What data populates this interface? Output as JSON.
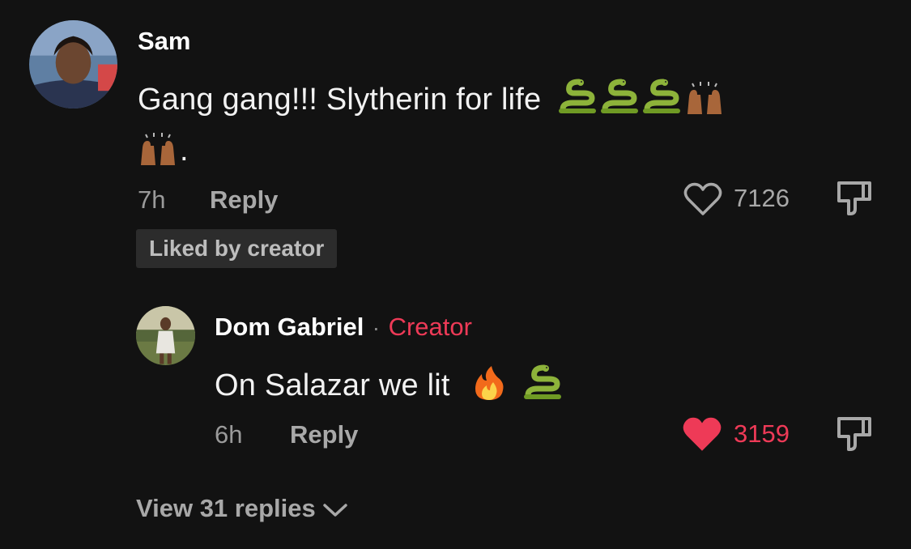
{
  "comment": {
    "author": "Sam",
    "text_line1": "Gang gang!!! Slytherin for life",
    "text_line2_suffix": ".",
    "emojis_line1": [
      "snake-emoji",
      "snake-emoji",
      "snake-emoji",
      "raising-hands-emoji"
    ],
    "emojis_line2": [
      "raising-hands-emoji"
    ],
    "time": "7h",
    "reply_label": "Reply",
    "like_count": "7126",
    "liked": false,
    "liked_by_creator_label": "Liked by creator"
  },
  "reply": {
    "author": "Dom Gabriel",
    "separator": "·",
    "creator_tag": "Creator",
    "text": "On Salazar we lit",
    "emojis": [
      "fire-emoji",
      "snake-emoji"
    ],
    "time": "6h",
    "reply_label": "Reply",
    "like_count": "3159",
    "liked": true
  },
  "view_replies_label": "View 31 replies",
  "colors": {
    "background": "#121212",
    "accent_red": "#ee3a57",
    "muted_text": "#a8a8a8",
    "badge_bg": "#2c2c2c"
  }
}
